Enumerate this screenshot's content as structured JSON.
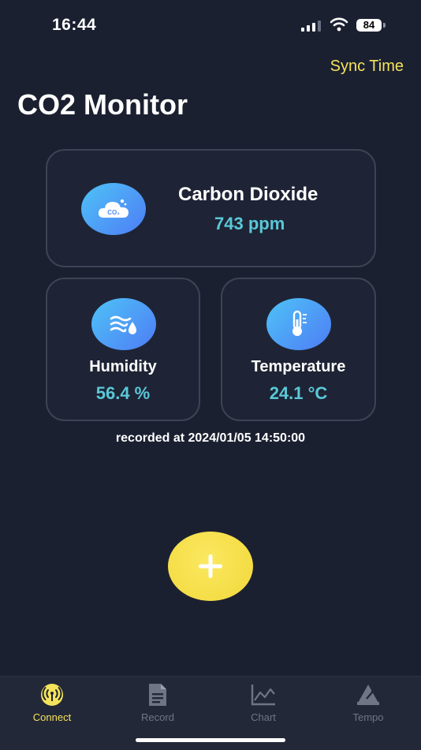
{
  "status_bar": {
    "time": "16:44",
    "battery": "84"
  },
  "header": {
    "sync_label": "Sync Time",
    "title": "CO2 Monitor"
  },
  "co2": {
    "icon_text": "CO₂",
    "label": "Carbon Dioxide",
    "value": "743 ppm"
  },
  "humidity": {
    "label": "Humidity",
    "value": "56.4 %"
  },
  "temperature": {
    "label": "Temperature",
    "value": "24.1 °C"
  },
  "recorded_text": "recorded at 2024/01/05 14:50:00",
  "tabs": [
    {
      "label": "Connect",
      "icon": "broadcast-icon",
      "active": true
    },
    {
      "label": "Record",
      "icon": "document-icon",
      "active": false
    },
    {
      "label": "Chart",
      "icon": "line-chart-icon",
      "active": false
    },
    {
      "label": "Tempo",
      "icon": "metronome-icon",
      "active": false
    }
  ],
  "colors": {
    "background": "#1b2031",
    "accent_yellow": "#f4e35a",
    "value_cyan": "#5ac8d8",
    "icon_gradient_start": "#4fc3f7",
    "icon_gradient_end": "#4d7cf5"
  }
}
